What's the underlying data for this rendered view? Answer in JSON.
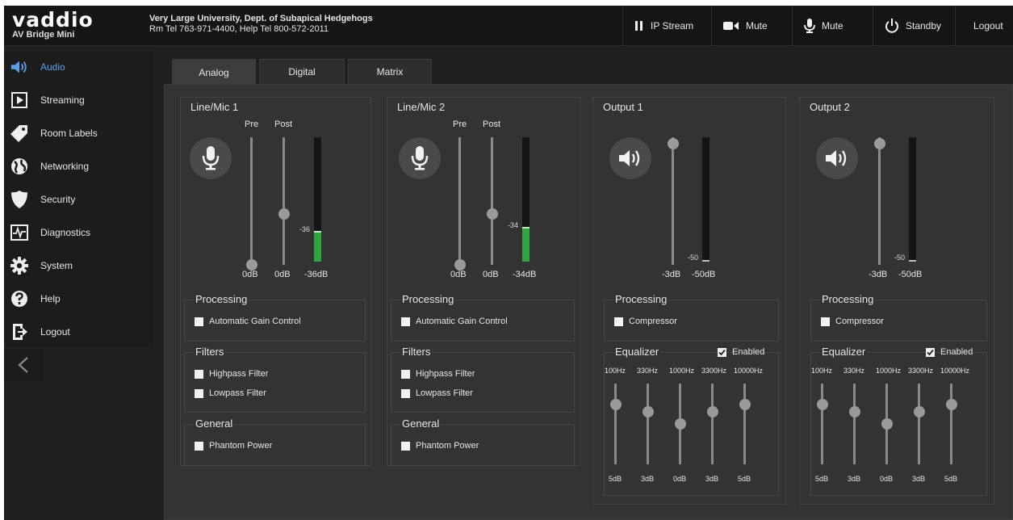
{
  "brand": {
    "name": "vaddio",
    "product": "AV Bridge Mini"
  },
  "site": {
    "line1": "Very Large University, Dept. of Subapical Hedgehogs",
    "line2": "Rm Tel 763-971-4400, Help Tel 800-572-2011"
  },
  "header_buttons": [
    {
      "label": "IP Stream",
      "icon": "pause-icon"
    },
    {
      "label": "Mute",
      "icon": "camera-icon"
    },
    {
      "label": "Mute",
      "icon": "microphone-icon"
    },
    {
      "label": "Standby",
      "icon": "power-icon"
    },
    {
      "label": "Logout",
      "icon": "logout-icon"
    }
  ],
  "sidebar": {
    "items": [
      {
        "label": "Audio",
        "icon": "speaker-icon",
        "active": true
      },
      {
        "label": "Streaming",
        "icon": "play-icon"
      },
      {
        "label": "Room Labels",
        "icon": "tag-icon"
      },
      {
        "label": "Networking",
        "icon": "globe-icon"
      },
      {
        "label": "Security",
        "icon": "shield-icon"
      },
      {
        "label": "Diagnostics",
        "icon": "pulse-icon"
      },
      {
        "label": "System",
        "icon": "gear-icon"
      },
      {
        "label": "Help",
        "icon": "help-icon"
      },
      {
        "label": "Logout",
        "icon": "logout-icon"
      }
    ],
    "collapse_glyph": "<"
  },
  "tabs": [
    {
      "label": "Analog",
      "active": true
    },
    {
      "label": "Digital"
    },
    {
      "label": "Matrix"
    }
  ],
  "colors": {
    "accent": "#5aa0e6",
    "meter": "#2fa640",
    "background": "#333333"
  },
  "inputs": [
    {
      "title": "Line/Mic 1",
      "pre_label": "Pre",
      "post_label": "Post",
      "pre_value": "0dB",
      "post_value": "0dB",
      "meter_value": "-36dB",
      "meter_marker": "-36",
      "pre_level": 0.0,
      "post_level": 0.4,
      "meter_level": 0.25,
      "processing": {
        "title": "Processing",
        "options": [
          "Automatic Gain Control"
        ]
      },
      "filters": {
        "title": "Filters",
        "options": [
          "Highpass Filter",
          "Lowpass Filter"
        ]
      },
      "general": {
        "title": "General",
        "options": [
          "Phantom Power"
        ]
      }
    },
    {
      "title": "Line/Mic 2",
      "pre_label": "Pre",
      "post_label": "Post",
      "pre_value": "0dB",
      "post_value": "0dB",
      "meter_value": "-34dB",
      "meter_marker": "-34",
      "pre_level": 0.0,
      "post_level": 0.4,
      "meter_level": 0.28,
      "processing": {
        "title": "Processing",
        "options": [
          "Automatic Gain Control"
        ]
      },
      "filters": {
        "title": "Filters",
        "options": [
          "Highpass Filter",
          "Lowpass Filter"
        ]
      },
      "general": {
        "title": "General",
        "options": [
          "Phantom Power"
        ]
      }
    }
  ],
  "outputs": [
    {
      "title": "Output 1",
      "volume_value": "-3dB",
      "meter_value": "-50dB",
      "meter_marker": "-50",
      "volume_level": 0.95,
      "meter_level": 0.0,
      "processing": {
        "title": "Processing",
        "options": [
          "Compressor"
        ]
      },
      "equalizer": {
        "title": "Equalizer",
        "enabled_label": "Enabled",
        "enabled": true,
        "bands": [
          "100Hz",
          "330Hz",
          "1000Hz",
          "3300Hz",
          "10000Hz"
        ],
        "values": [
          "5dB",
          "3dB",
          "0dB",
          "3dB",
          "5dB"
        ],
        "levels": [
          0.74,
          0.65,
          0.5,
          0.65,
          0.74
        ]
      }
    },
    {
      "title": "Output 2",
      "volume_value": "-3dB",
      "meter_value": "-50dB",
      "meter_marker": "-50",
      "volume_level": 0.95,
      "meter_level": 0.0,
      "processing": {
        "title": "Processing",
        "options": [
          "Compressor"
        ]
      },
      "equalizer": {
        "title": "Equalizer",
        "enabled_label": "Enabled",
        "enabled": true,
        "bands": [
          "100Hz",
          "330Hz",
          "1000Hz",
          "3300Hz",
          "10000Hz"
        ],
        "values": [
          "5dB",
          "3dB",
          "0dB",
          "3dB",
          "5dB"
        ],
        "levels": [
          0.74,
          0.65,
          0.5,
          0.65,
          0.74
        ]
      }
    }
  ]
}
